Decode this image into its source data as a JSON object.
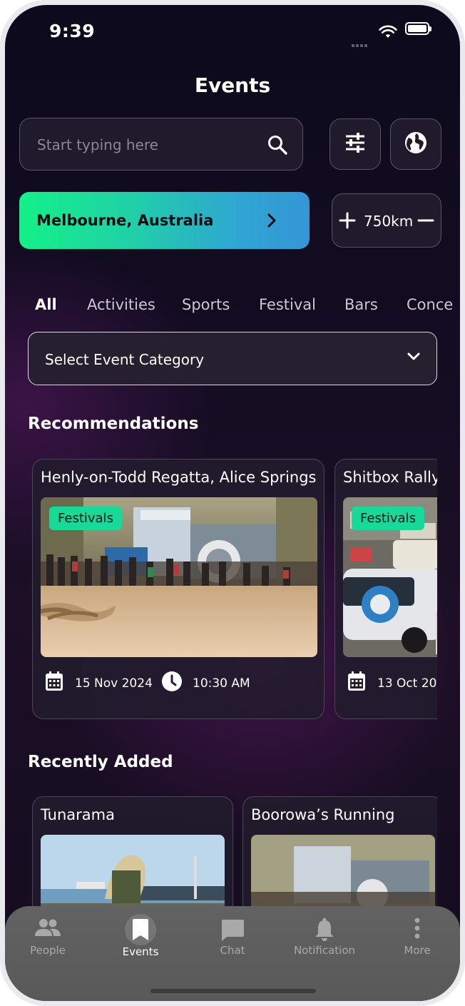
{
  "status_bar": {
    "time": "9:39"
  },
  "header": {
    "title": "Events"
  },
  "search": {
    "placeholder": "Start typing here"
  },
  "location": {
    "label": "Melbourne, Australia"
  },
  "radius": {
    "value": "750km"
  },
  "tabs": [
    {
      "label": "All",
      "active": true
    },
    {
      "label": "Activities"
    },
    {
      "label": "Sports"
    },
    {
      "label": "Festival"
    },
    {
      "label": "Bars"
    },
    {
      "label": "Conce"
    }
  ],
  "category_select": {
    "label": "Select Event Category"
  },
  "recommendations": {
    "heading": "Recommendations",
    "cards": [
      {
        "title": "Henly-on-Todd Regatta, Alice Springs",
        "tag": "Festivals",
        "date": "15 Nov 2024",
        "time": "10:30 AM"
      },
      {
        "title": "Shitbox Rally",
        "tag": "Festivals",
        "date": "13 Oct 202"
      }
    ]
  },
  "recently_added": {
    "heading": "Recently Added",
    "cards": [
      {
        "title": "Tunarama"
      },
      {
        "title": "Boorowa’s Running"
      }
    ]
  },
  "bottom_nav": [
    {
      "label": "People",
      "icon": "people-icon"
    },
    {
      "label": "Events",
      "icon": "bookmark-icon",
      "active": true
    },
    {
      "label": "Chat",
      "icon": "chat-icon"
    },
    {
      "label": "Notification",
      "icon": "bell-icon"
    },
    {
      "label": "More",
      "icon": "more-vertical-icon"
    }
  ],
  "colors": {
    "accent_green": "#19d999",
    "location_gradient_start": "#14f089",
    "location_gradient_end": "#3596d7",
    "background": "#150d23"
  }
}
